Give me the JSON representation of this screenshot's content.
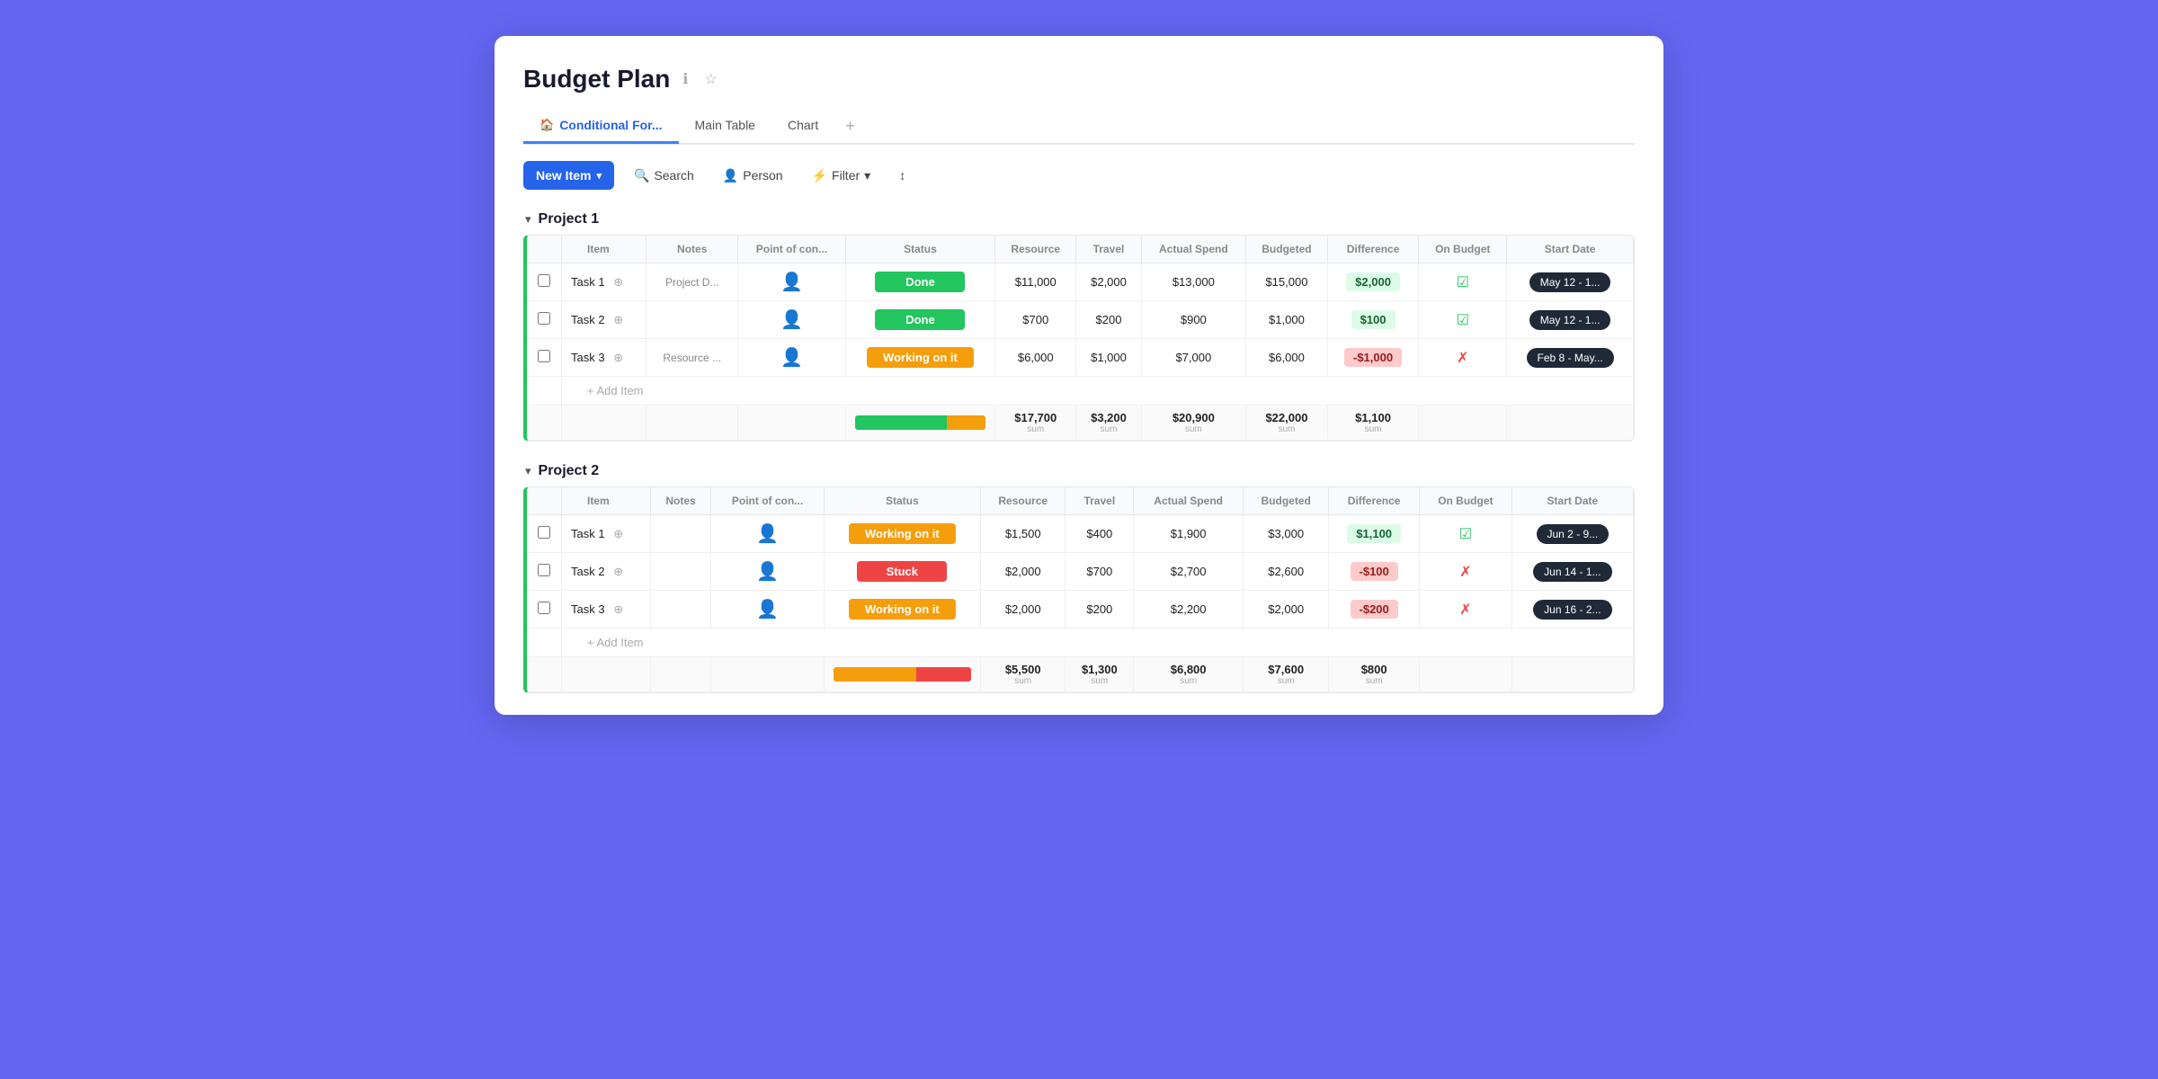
{
  "page": {
    "title": "Budget Plan",
    "tabs": [
      {
        "label": "Conditional For...",
        "icon": "home",
        "active": true
      },
      {
        "label": "Main Table",
        "active": false
      },
      {
        "label": "Chart",
        "active": false
      },
      {
        "label": "+",
        "active": false
      }
    ],
    "toolbar": {
      "new_item": "New Item",
      "search": "Search",
      "person": "Person",
      "filter": "Filter",
      "sort": "Sort"
    }
  },
  "projects": [
    {
      "name": "Project 1",
      "color": "#22c55e",
      "columns": [
        "Item",
        "Notes",
        "Point of con...",
        "Status",
        "Resource",
        "Travel",
        "Actual Spend",
        "Budgeted",
        "Difference",
        "On Budget",
        "Start Date"
      ],
      "rows": [
        {
          "item": "Task 1",
          "notes": "Project D...",
          "status": "Done",
          "status_class": "status-done",
          "resource": "$11,000",
          "travel": "$2,000",
          "actual_spend": "$13,000",
          "budgeted": "$15,000",
          "difference": "$2,000",
          "diff_class": "diff-positive",
          "on_budget": true,
          "date": "May 12 - 1..."
        },
        {
          "item": "Task 2",
          "notes": "",
          "status": "Done",
          "status_class": "status-done",
          "resource": "$700",
          "travel": "$200",
          "actual_spend": "$900",
          "budgeted": "$1,000",
          "difference": "$100",
          "diff_class": "diff-positive",
          "on_budget": true,
          "date": "May 12 - 1..."
        },
        {
          "item": "Task 3",
          "notes": "Resource ...",
          "status": "Working on it",
          "status_class": "status-working",
          "resource": "$6,000",
          "travel": "$1,000",
          "actual_spend": "$7,000",
          "budgeted": "$6,000",
          "difference": "-$1,000",
          "diff_class": "diff-negative",
          "on_budget": false,
          "date": "Feb 8 - May..."
        }
      ],
      "sum": {
        "resource": "$17,700",
        "travel": "$3,200",
        "actual_spend": "$20,900",
        "budgeted": "$22,000",
        "difference": "$1,100",
        "progress": [
          {
            "color": "#22c55e",
            "pct": 70
          },
          {
            "color": "#f59e0b",
            "pct": 30
          }
        ]
      }
    },
    {
      "name": "Project 2",
      "color": "#22c55e",
      "columns": [
        "Item",
        "Notes",
        "Point of con...",
        "Status",
        "Resource",
        "Travel",
        "Actual Spend",
        "Budgeted",
        "Difference",
        "On Budget",
        "Start Date"
      ],
      "rows": [
        {
          "item": "Task 1",
          "notes": "",
          "status": "Working on it",
          "status_class": "status-working",
          "resource": "$1,500",
          "travel": "$400",
          "actual_spend": "$1,900",
          "budgeted": "$3,000",
          "difference": "$1,100",
          "diff_class": "diff-positive",
          "on_budget": true,
          "date": "Jun 2 - 9..."
        },
        {
          "item": "Task 2",
          "notes": "",
          "status": "Stuck",
          "status_class": "status-stuck",
          "resource": "$2,000",
          "travel": "$700",
          "actual_spend": "$2,700",
          "budgeted": "$2,600",
          "difference": "-$100",
          "diff_class": "diff-negative",
          "on_budget": false,
          "date": "Jun 14 - 1..."
        },
        {
          "item": "Task 3",
          "notes": "",
          "status": "Working on it",
          "status_class": "status-working",
          "resource": "$2,000",
          "travel": "$200",
          "actual_spend": "$2,200",
          "budgeted": "$2,000",
          "difference": "-$200",
          "diff_class": "diff-negative",
          "on_budget": false,
          "date": "Jun 16 - 2..."
        }
      ],
      "sum": {
        "resource": "$5,500",
        "travel": "$1,300",
        "actual_spend": "$6,800",
        "budgeted": "$7,600",
        "difference": "$800",
        "progress": [
          {
            "color": "#f59e0b",
            "pct": 60
          },
          {
            "color": "#ef4444",
            "pct": 40
          }
        ]
      }
    }
  ]
}
